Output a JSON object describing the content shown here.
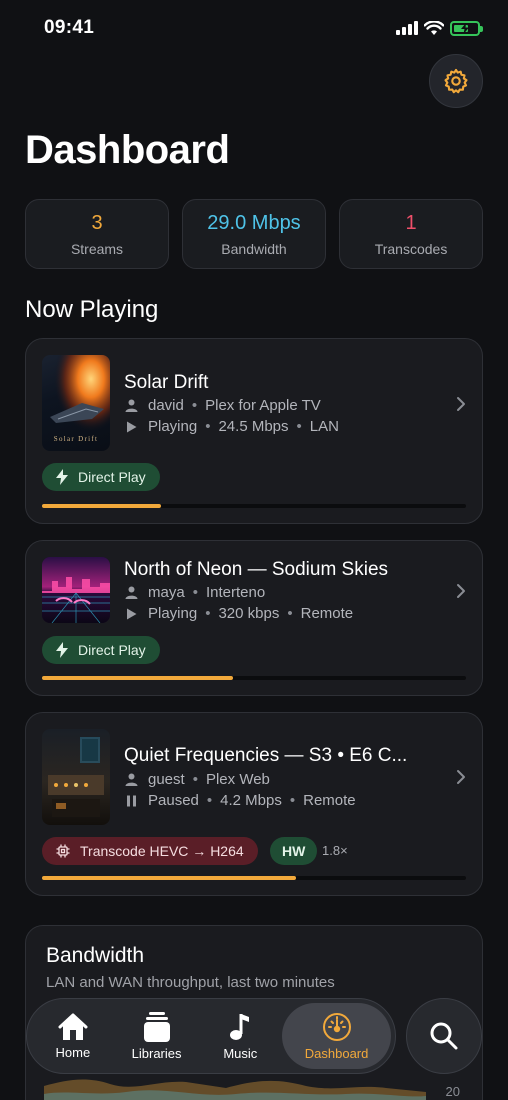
{
  "status": {
    "time": "09:41"
  },
  "header": {
    "title": "Dashboard"
  },
  "stats": [
    {
      "value": "3",
      "label": "Streams",
      "color": "#f2a93b"
    },
    {
      "value": "29.0 Mbps",
      "label": "Bandwidth",
      "color": "#4fc3e8"
    },
    {
      "value": "1",
      "label": "Transcodes",
      "color": "#ef4f6a"
    }
  ],
  "now_playing": {
    "title": "Now Playing",
    "sessions": [
      {
        "title": "Solar Drift",
        "user": "david",
        "client": "Plex for Apple TV",
        "state": "Playing",
        "state_icon": "play-icon",
        "bitrate": "24.5 Mbps",
        "location": "LAN",
        "badge": "Direct Play",
        "badge_icon": "bolt-icon",
        "progress": 0.28,
        "thumb_caption": "Solar Drift"
      },
      {
        "title": "North of Neon — Sodium Skies",
        "user": "maya",
        "client": "Interteno",
        "state": "Playing",
        "state_icon": "play-icon",
        "bitrate": "320 kbps",
        "location": "Remote",
        "badge": "Direct Play",
        "badge_icon": "bolt-icon",
        "progress": 0.45
      },
      {
        "title": "Quiet Frequencies — S3 • E6 C...",
        "user": "guest",
        "client": "Plex Web",
        "state": "Paused",
        "state_icon": "pause-icon",
        "bitrate": "4.2 Mbps",
        "location": "Remote",
        "badge": "Transcode HEVC → H264",
        "badge_icon": "chip-icon",
        "hw_badge": "HW",
        "speed": "1.8×",
        "progress": 0.6
      }
    ]
  },
  "bandwidth_card": {
    "title": "Bandwidth",
    "subtitle": "LAN and WAN throughput, last two minutes",
    "tick": "20"
  },
  "tabbar": {
    "tabs": [
      {
        "label": "Home",
        "icon": "home-icon"
      },
      {
        "label": "Libraries",
        "icon": "libraries-icon"
      },
      {
        "label": "Music",
        "icon": "music-note-icon"
      },
      {
        "label": "Dashboard",
        "icon": "gauge-icon",
        "active": true
      }
    ],
    "search_icon": "search-icon"
  },
  "colors": {
    "accent": "#f2a93b",
    "direct_play_bg": "#1f4d34",
    "transcode_bg": "#5a1e27"
  }
}
